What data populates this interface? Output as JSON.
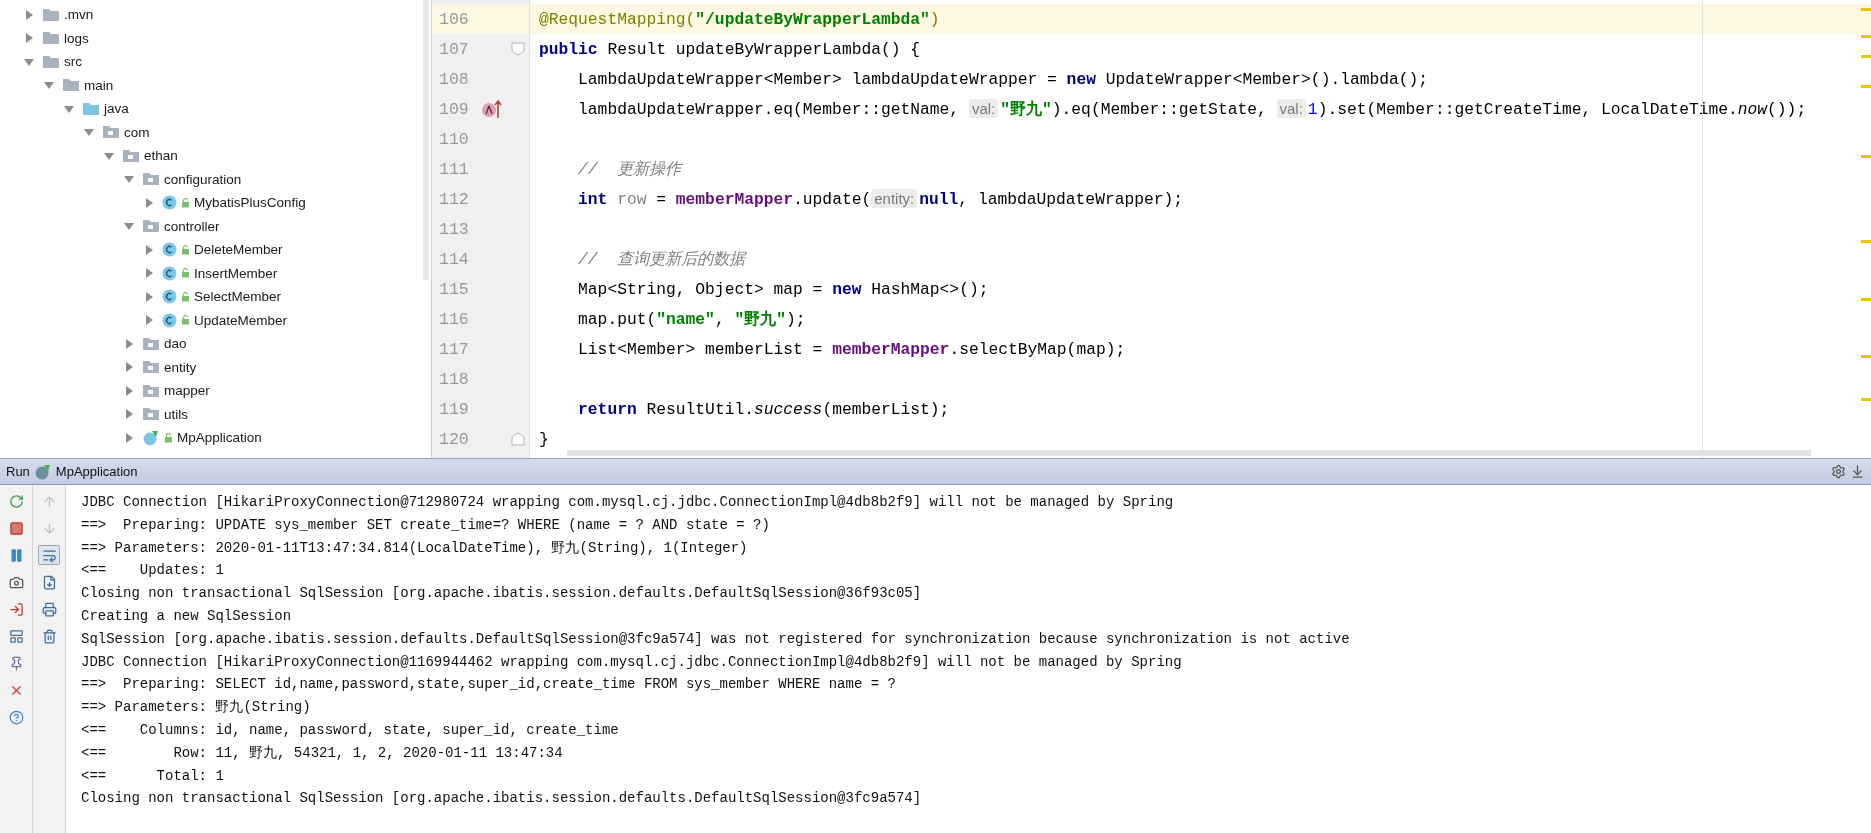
{
  "project_tree": {
    "items": [
      {
        "name": ".mvn",
        "kind": "folder",
        "expanded": false
      },
      {
        "name": "logs",
        "kind": "folder",
        "expanded": false
      },
      {
        "name": "src",
        "kind": "folder",
        "expanded": true,
        "children": [
          {
            "name": "main",
            "kind": "folder",
            "expanded": true,
            "children": [
              {
                "name": "java",
                "kind": "source",
                "expanded": true,
                "children": [
                  {
                    "name": "com",
                    "kind": "package",
                    "expanded": true,
                    "children": [
                      {
                        "name": "ethan",
                        "kind": "package",
                        "expanded": true,
                        "children": [
                          {
                            "name": "configuration",
                            "kind": "package",
                            "expanded": true,
                            "children": [
                              {
                                "name": "MybatisPlusConfig",
                                "kind": "class",
                                "expanded": false
                              }
                            ]
                          },
                          {
                            "name": "controller",
                            "kind": "package",
                            "expanded": true,
                            "children": [
                              {
                                "name": "DeleteMember",
                                "kind": "class",
                                "expanded": false
                              },
                              {
                                "name": "InsertMember",
                                "kind": "class",
                                "expanded": false
                              },
                              {
                                "name": "SelectMember",
                                "kind": "class",
                                "expanded": false
                              },
                              {
                                "name": "UpdateMember",
                                "kind": "class",
                                "expanded": false
                              }
                            ]
                          },
                          {
                            "name": "dao",
                            "kind": "package",
                            "expanded": false
                          },
                          {
                            "name": "entity",
                            "kind": "package",
                            "expanded": false
                          },
                          {
                            "name": "mapper",
                            "kind": "package",
                            "expanded": false
                          },
                          {
                            "name": "utils",
                            "kind": "package",
                            "expanded": false
                          },
                          {
                            "name": "MpApplication",
                            "kind": "app",
                            "expanded": false
                          }
                        ]
                      }
                    ]
                  }
                ]
              }
            ]
          }
        ]
      }
    ]
  },
  "editor": {
    "lines": [
      {
        "number": "106",
        "current": true,
        "kind": "code",
        "tokens": [
          {
            "kind": "annotation",
            "text": "@RequestMapping("
          },
          {
            "kind": "string",
            "text": "\"/updateByWrapperLambda\""
          },
          {
            "kind": "annotation",
            "text": ")"
          }
        ]
      },
      {
        "number": "107",
        "current": false,
        "kind": "fold_start",
        "tokens": [
          {
            "kind": "keyword",
            "text": "public"
          },
          {
            "kind": "plain",
            "text": " Result updateByWrapperLambda() {"
          }
        ]
      },
      {
        "number": "108",
        "current": false,
        "kind": "code",
        "tokens": [
          {
            "kind": "plain",
            "text": "    LambdaUpdateWrapper<Member> lambdaUpdateWrapper = "
          },
          {
            "kind": "keyword",
            "text": "new"
          },
          {
            "kind": "plain",
            "text": " UpdateWrapper<Member>().lambda();"
          }
        ]
      },
      {
        "number": "109",
        "current": false,
        "kind": "lambda_call",
        "tokens": [
          {
            "kind": "plain",
            "text": "    lambdaUpdateWrapper.eq(Member::getName, "
          },
          {
            "kind": "hint",
            "text": "val:"
          },
          {
            "kind": "string",
            "text": "\"野九\""
          },
          {
            "kind": "plain",
            "text": ").eq(Member::getState, "
          },
          {
            "kind": "hint",
            "text": "val:"
          },
          {
            "kind": "number",
            "text": "1"
          },
          {
            "kind": "plain",
            "text": ").set(Member::getCreateTime, LocalDateTime."
          },
          {
            "kind": "italic",
            "text": "now"
          },
          {
            "kind": "plain",
            "text": "());"
          }
        ]
      },
      {
        "number": "110",
        "current": false,
        "kind": "code"
      },
      {
        "number": "111",
        "current": false,
        "kind": "code",
        "tokens": [
          {
            "kind": "comment",
            "text": "    //  更新操作"
          }
        ]
      },
      {
        "number": "112",
        "current": false,
        "kind": "code",
        "tokens": [
          {
            "kind": "keyword",
            "text": "    int"
          },
          {
            "kind": "unused",
            "text": " row"
          },
          {
            "kind": "plain",
            "text": " = "
          },
          {
            "kind": "field",
            "text": "memberMapper"
          },
          {
            "kind": "plain",
            "text": ".update("
          },
          {
            "kind": "hint",
            "text": "entity:"
          },
          {
            "kind": "keyword",
            "text": "null"
          },
          {
            "kind": "plain",
            "text": ", lambdaUpdateWrapper);"
          }
        ]
      },
      {
        "number": "113",
        "current": false,
        "kind": "code"
      },
      {
        "number": "114",
        "current": false,
        "kind": "code",
        "tokens": [
          {
            "kind": "comment",
            "text": "    //  查询更新后的数据"
          }
        ]
      },
      {
        "number": "115",
        "current": false,
        "kind": "code",
        "tokens": [
          {
            "kind": "plain",
            "text": "    Map<String, Object> map = "
          },
          {
            "kind": "keyword",
            "text": "new"
          },
          {
            "kind": "plain",
            "text": " HashMap<>();"
          }
        ]
      },
      {
        "number": "116",
        "current": false,
        "kind": "code",
        "tokens": [
          {
            "kind": "plain",
            "text": "    map.put("
          },
          {
            "kind": "string",
            "text": "\"name\""
          },
          {
            "kind": "plain",
            "text": ", "
          },
          {
            "kind": "string",
            "text": "\"野九\""
          },
          {
            "kind": "plain",
            "text": ");"
          }
        ]
      },
      {
        "number": "117",
        "current": false,
        "kind": "code",
        "tokens": [
          {
            "kind": "plain",
            "text": "    List<Member> memberList = "
          },
          {
            "kind": "field",
            "text": "memberMapper"
          },
          {
            "kind": "plain",
            "text": ".selectByMap(map);"
          }
        ]
      },
      {
        "number": "118",
        "current": false,
        "kind": "code"
      },
      {
        "number": "119",
        "current": false,
        "kind": "code",
        "tokens": [
          {
            "kind": "keyword",
            "text": "    return"
          },
          {
            "kind": "plain",
            "text": " ResultUtil."
          },
          {
            "kind": "italic",
            "text": "success"
          },
          {
            "kind": "plain",
            "text": "(memberList);"
          }
        ]
      },
      {
        "number": "120",
        "current": false,
        "kind": "fold_end",
        "tokens": [
          {
            "kind": "plain",
            "text": "}"
          }
        ]
      }
    ]
  },
  "run_panel": {
    "label": "Run",
    "configuration": "MpApplication",
    "soft_wrap_on": true,
    "history_nav_disabled": true,
    "console": [
      "JDBC Connection [HikariProxyConnection@712980724 wrapping com.mysql.cj.jdbc.ConnectionImpl@4db8b2f9] will not be managed by Spring",
      "==>  Preparing: UPDATE sys_member SET create_time=? WHERE (name = ? AND state = ?)",
      "==> Parameters: 2020-01-11T13:47:34.814(LocalDateTime), 野九(String), 1(Integer)",
      "<==    Updates: 1",
      "Closing non transactional SqlSession [org.apache.ibatis.session.defaults.DefaultSqlSession@36f93c05]",
      "Creating a new SqlSession",
      "SqlSession [org.apache.ibatis.session.defaults.DefaultSqlSession@3fc9a574] was not registered for synchronization because synchronization is not active",
      "JDBC Connection [HikariProxyConnection@1169944462 wrapping com.mysql.cj.jdbc.ConnectionImpl@4db8b2f9] will not be managed by Spring",
      "==>  Preparing: SELECT id,name,password,state,super_id,create_time FROM sys_member WHERE name = ?",
      "==> Parameters: 野九(String)",
      "<==    Columns: id, name, password, state, super_id, create_time",
      "<==        Row: 11, 野九, 54321, 1, 2, 2020-01-11 13:47:34",
      "<==      Total: 1",
      "Closing non transactional SqlSession [org.apache.ibatis.session.defaults.DefaultSqlSession@3fc9a574]"
    ]
  }
}
